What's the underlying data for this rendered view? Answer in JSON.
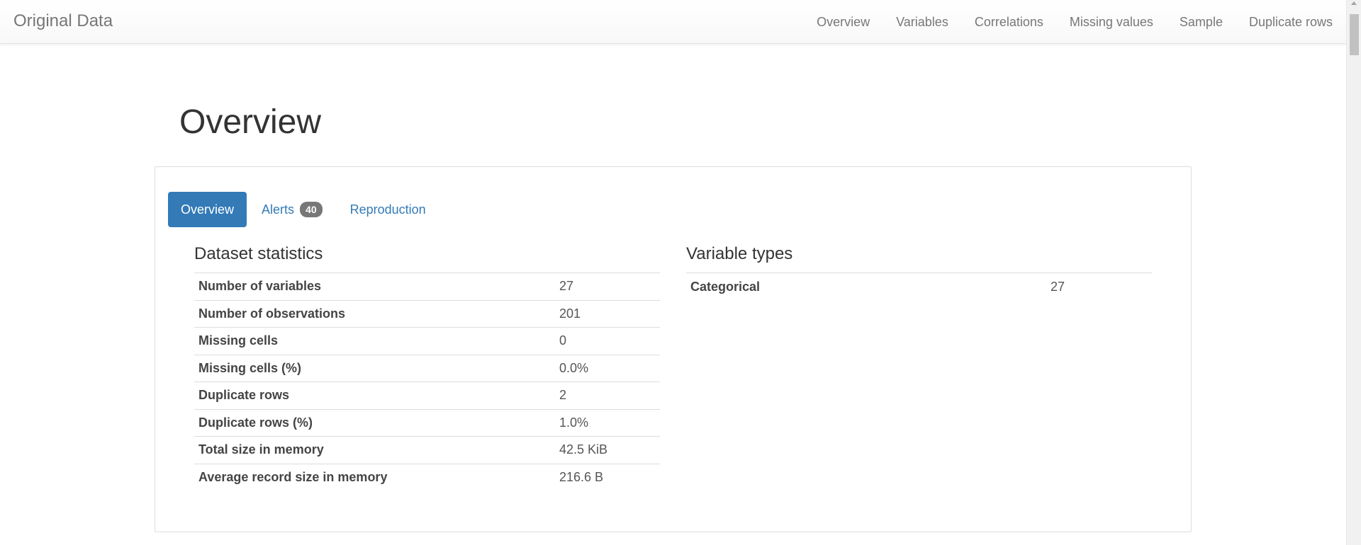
{
  "navbar": {
    "brand": "Original Data",
    "links": [
      "Overview",
      "Variables",
      "Correlations",
      "Missing values",
      "Sample",
      "Duplicate rows"
    ]
  },
  "page": {
    "title": "Overview"
  },
  "tabs": {
    "overview": "Overview",
    "alerts": "Alerts",
    "alerts_count": "40",
    "reproduction": "Reproduction",
    "active": "Overview"
  },
  "dataset_statistics": {
    "title": "Dataset statistics",
    "rows": [
      {
        "label": "Number of variables",
        "value": "27"
      },
      {
        "label": "Number of observations",
        "value": "201"
      },
      {
        "label": "Missing cells",
        "value": "0"
      },
      {
        "label": "Missing cells (%)",
        "value": "0.0%"
      },
      {
        "label": "Duplicate rows",
        "value": "2"
      },
      {
        "label": "Duplicate rows (%)",
        "value": "1.0%"
      },
      {
        "label": "Total size in memory",
        "value": "42.5 KiB"
      },
      {
        "label": "Average record size in memory",
        "value": "216.6 B"
      }
    ]
  },
  "variable_types": {
    "title": "Variable types",
    "rows": [
      {
        "label": "Categorical",
        "value": "27"
      }
    ]
  },
  "colors": {
    "accent": "#337ab7",
    "badge": "#777777",
    "nav_text": "#777777"
  }
}
